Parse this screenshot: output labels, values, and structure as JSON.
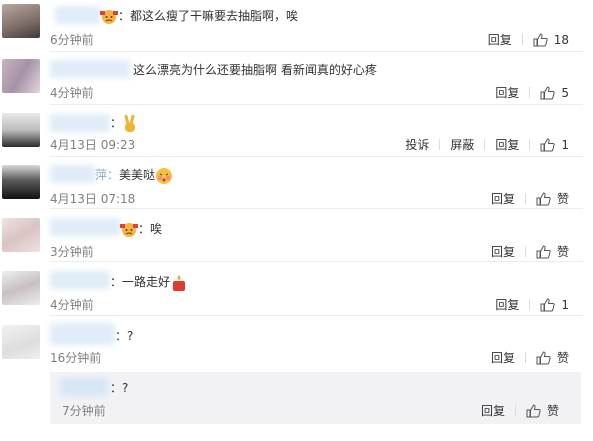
{
  "comments": [
    {
      "prefix": "：",
      "text": "都这么瘦了干嘛要去抽脂啊，唉",
      "time": "6分钟前",
      "reply": "回复",
      "likes": "18",
      "emoji": "sad-face"
    },
    {
      "prefix": "",
      "text": "这么漂亮为什么还要抽脂啊 看新闻真的好心疼",
      "time": "4分钟前",
      "reply": "回复",
      "likes": "5"
    },
    {
      "prefix": "：",
      "text": "",
      "time": "4月13日 09:23",
      "report": "投诉",
      "block": "屏蔽",
      "reply": "回复",
      "likes": "1",
      "emoji": "victory-hand"
    },
    {
      "prefix": "萍：",
      "text": "美美哒",
      "time": "4月13日 07:18",
      "reply": "回复",
      "likes": "赞",
      "emoji": "blush-face"
    },
    {
      "prefix": "：",
      "text": "唉",
      "time": "3分钟前",
      "reply": "回复",
      "likes": "赞",
      "emoji": "sad-face"
    },
    {
      "prefix": "：",
      "text": "一路走好",
      "time": "4分钟前",
      "reply": "回复",
      "likes": "1",
      "emoji": "candle"
    },
    {
      "prefix": "：",
      "text": "?",
      "time": "16分钟前",
      "reply": "回复",
      "likes": "赞"
    }
  ],
  "sub_reply": {
    "prefix": "：",
    "text": "?",
    "time": "7分钟前",
    "reply": "回复",
    "likes": "赞"
  },
  "colors": {
    "text": "#333333",
    "time": "#808080",
    "blur_blue": "#dbe9f6",
    "reply_bg": "#f2f2f5"
  }
}
